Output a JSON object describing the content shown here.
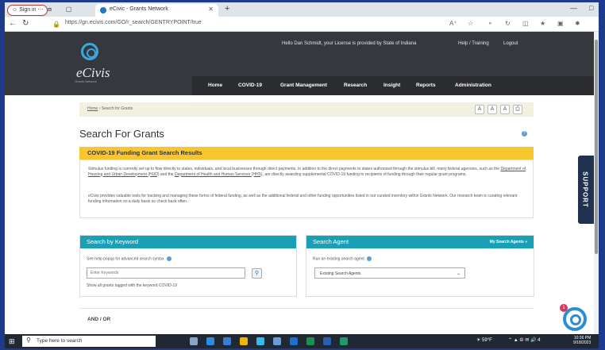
{
  "browser": {
    "signin_label": "Sign in",
    "tab_title": "eCivic - Grants Network",
    "url": "https://gn.ecivis.com/GO/r_search/GENTRYPOINT/true"
  },
  "header": {
    "logo_text": "eCivis",
    "logo_tagline": "Grants Network",
    "greeting": "Hello Dan Schmidt, your License is provided by State of Indiana",
    "help_training": "Help / Training",
    "logout": "Logout",
    "nav": [
      "Home",
      "COVID-19",
      "Grant Management",
      "Research",
      "Insight",
      "Reports",
      "Administration"
    ]
  },
  "breadcrumb": {
    "home": "Home",
    "current": "Search for Grants"
  },
  "page_title": "Search For Grants",
  "covid": {
    "title": "COVID-19 Funding Grant Search Results",
    "p1_a": "Stimulus funding is currently set up to flow directly to states, individuals, and local businesses through direct payments. In addition to the direct payments to states authorized through the stimulus bill, many federal agencies, such as the ",
    "p1_link1": "Department of Housing and Urban Development (HUD)",
    "p1_b": " and the ",
    "p1_link2": "Department of Health and Human Services (HHS)",
    "p1_c": ", are directly awarding supplemental COVID-19 funding to recipients of funding through their regular grant programs.",
    "p2": "eCivis provides valuable tools for tracking and managing these forms of federal funding, as well as the additional federal and other funding opportunities listed in our curated inventory within Grants Network. Our research team is curating relevant funding information on a daily basis so check back often."
  },
  "keyword_panel": {
    "title": "Search by Keyword",
    "help": "See help popup for advanced search syntax",
    "placeholder": "Enter Keywords",
    "tagged": "Show all grants tagged with the keyword COVID-19"
  },
  "agent_panel": {
    "title": "Search Agent",
    "link": "My Search Agents »",
    "help": "Run an existing search agent",
    "select_value": "Existing Search Agents"
  },
  "and_or": "AND / OR",
  "support_label": "SUPPORT",
  "chat_count": "1",
  "taskbar": {
    "search_placeholder": "Type here to search",
    "weather": "59°F",
    "time": "10:36 PM",
    "date": "9/18/2023"
  },
  "colors": {
    "header_dark": "#35383d",
    "teal": "#1aa0b4",
    "yellow": "#f7c631",
    "support_navy": "#20324f"
  }
}
